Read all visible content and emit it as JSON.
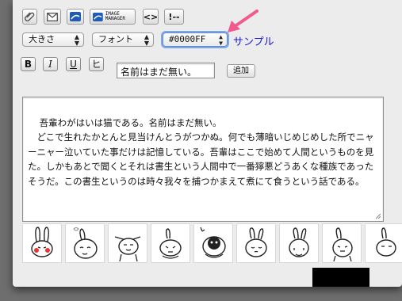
{
  "toolbar": {
    "image_manager_label": "IMAGE MANAGER",
    "code_label": "<>",
    "comment_label": "!--"
  },
  "format": {
    "size_select": "大きさ",
    "font_select": "フォント",
    "color_select": "#0000FF",
    "sample_text": "サンプル",
    "colors": {
      "sample": "#1a1ad6",
      "arrow": "#f05a8c"
    }
  },
  "buttons": {
    "bold": "B",
    "italic": "I",
    "underline": "U",
    "strike": "ヒ",
    "add": "追加"
  },
  "input": {
    "value": "名前はまだ無い。"
  },
  "editor": {
    "text": "吾輩わがはいは猫である。名前はまだ無い。\n　どこで生れたかとんと見当けんとうがつかぬ。何でも薄暗いじめじめした所でニャーニャー泣いていた事だけは記憶している。吾輩はここで始めて人間というものを見た。しかもあとで聞くとそれは書生という人間中で一番獰悪どうあくな種族であったそうだ。この書生というのは時々我々を捕つかまえて煮にて食うという話である。"
  },
  "stamps": [
    "stamp-1",
    "stamp-2",
    "stamp-3",
    "stamp-4",
    "stamp-5",
    "stamp-6",
    "stamp-7",
    "stamp-8",
    "stamp-9"
  ],
  "icons": [
    "paperclip-icon",
    "envelope-icon",
    "image-icon"
  ]
}
